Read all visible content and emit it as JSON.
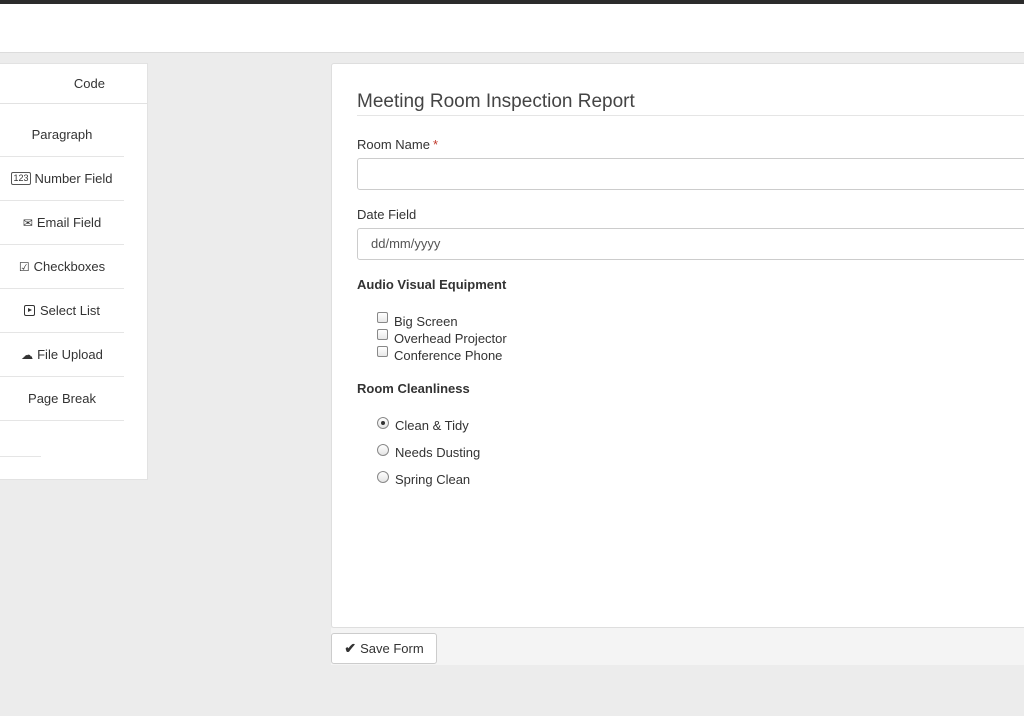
{
  "palette": {
    "tab_label": "Code",
    "items": [
      {
        "label": "Paragraph",
        "icon": ""
      },
      {
        "label": "Number Field",
        "icon": "123"
      },
      {
        "label": "Email Field",
        "icon": "envelope-icon"
      },
      {
        "label": "Checkboxes",
        "icon": "check-square-icon"
      },
      {
        "label": "Select List",
        "icon": "caret-square-icon"
      },
      {
        "label": "File Upload",
        "icon": "cloud-upload-icon"
      },
      {
        "label": "Page Break",
        "icon": ""
      }
    ]
  },
  "form": {
    "title": "Meeting Room Inspection Report",
    "room_name": {
      "label": "Room Name",
      "required_mark": "*",
      "value": ""
    },
    "date_field": {
      "label": "Date Field",
      "placeholder": "dd/mm/yyyy"
    },
    "av_equipment": {
      "label": "Audio Visual Equipment",
      "options": [
        {
          "label": "Big Screen",
          "checked": false
        },
        {
          "label": "Overhead Projector",
          "checked": false
        },
        {
          "label": "Conference Phone",
          "checked": false
        }
      ]
    },
    "cleanliness": {
      "label": "Room Cleanliness",
      "options": [
        {
          "label": "Clean & Tidy",
          "selected": true
        },
        {
          "label": "Needs Dusting",
          "selected": false
        },
        {
          "label": "Spring Clean",
          "selected": false
        }
      ]
    }
  },
  "save_label": "Save Form",
  "colors": {
    "required": "#c0392b",
    "topbar": "#2b2b2b",
    "background": "#ececec"
  }
}
